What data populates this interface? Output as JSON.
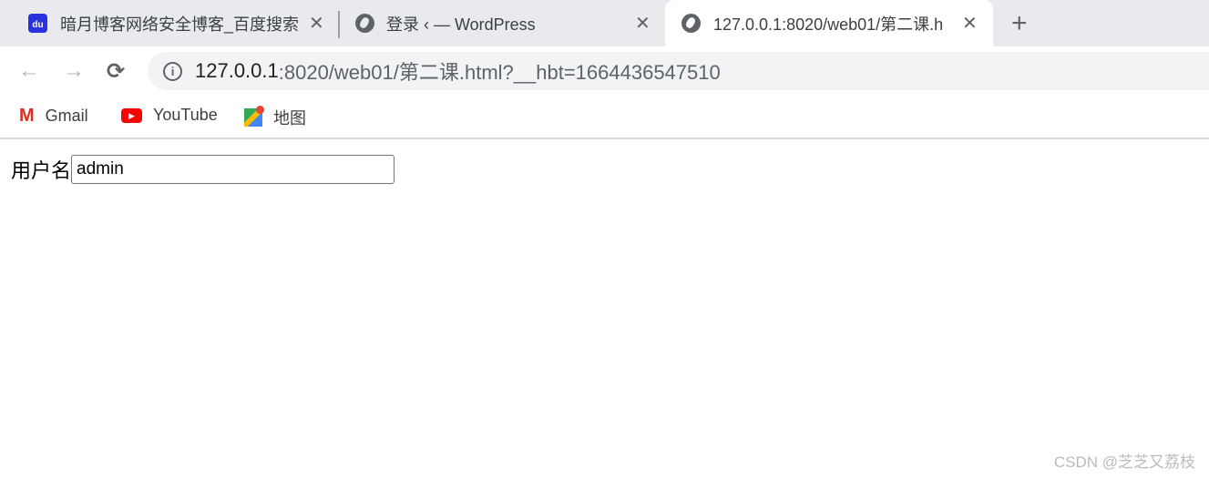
{
  "tabs": [
    {
      "title": "暗月博客网络安全博客_百度搜索",
      "icon": "baidu-paw-icon",
      "active": false
    },
    {
      "title": "登录 ‹ — WordPress",
      "icon": "globe-icon",
      "active": false
    },
    {
      "title": "127.0.0.1:8020/web01/第二课.h",
      "icon": "globe-icon",
      "active": true
    }
  ],
  "toolbar": {
    "back": "←",
    "forward": "→",
    "reload": "⟳",
    "url_host": "127.0.0.1",
    "url_path": ":8020/web01/第二课.html?__hbt=1664436547510"
  },
  "bookmarks": [
    {
      "label": "Gmail",
      "icon": "gmail-icon"
    },
    {
      "label": "YouTube",
      "icon": "youtube-icon"
    },
    {
      "label": "地图",
      "icon": "maps-icon"
    }
  ],
  "page": {
    "username_label": "用户名",
    "username_value": "admin"
  },
  "watermark": "CSDN @芝芝又荔枝"
}
